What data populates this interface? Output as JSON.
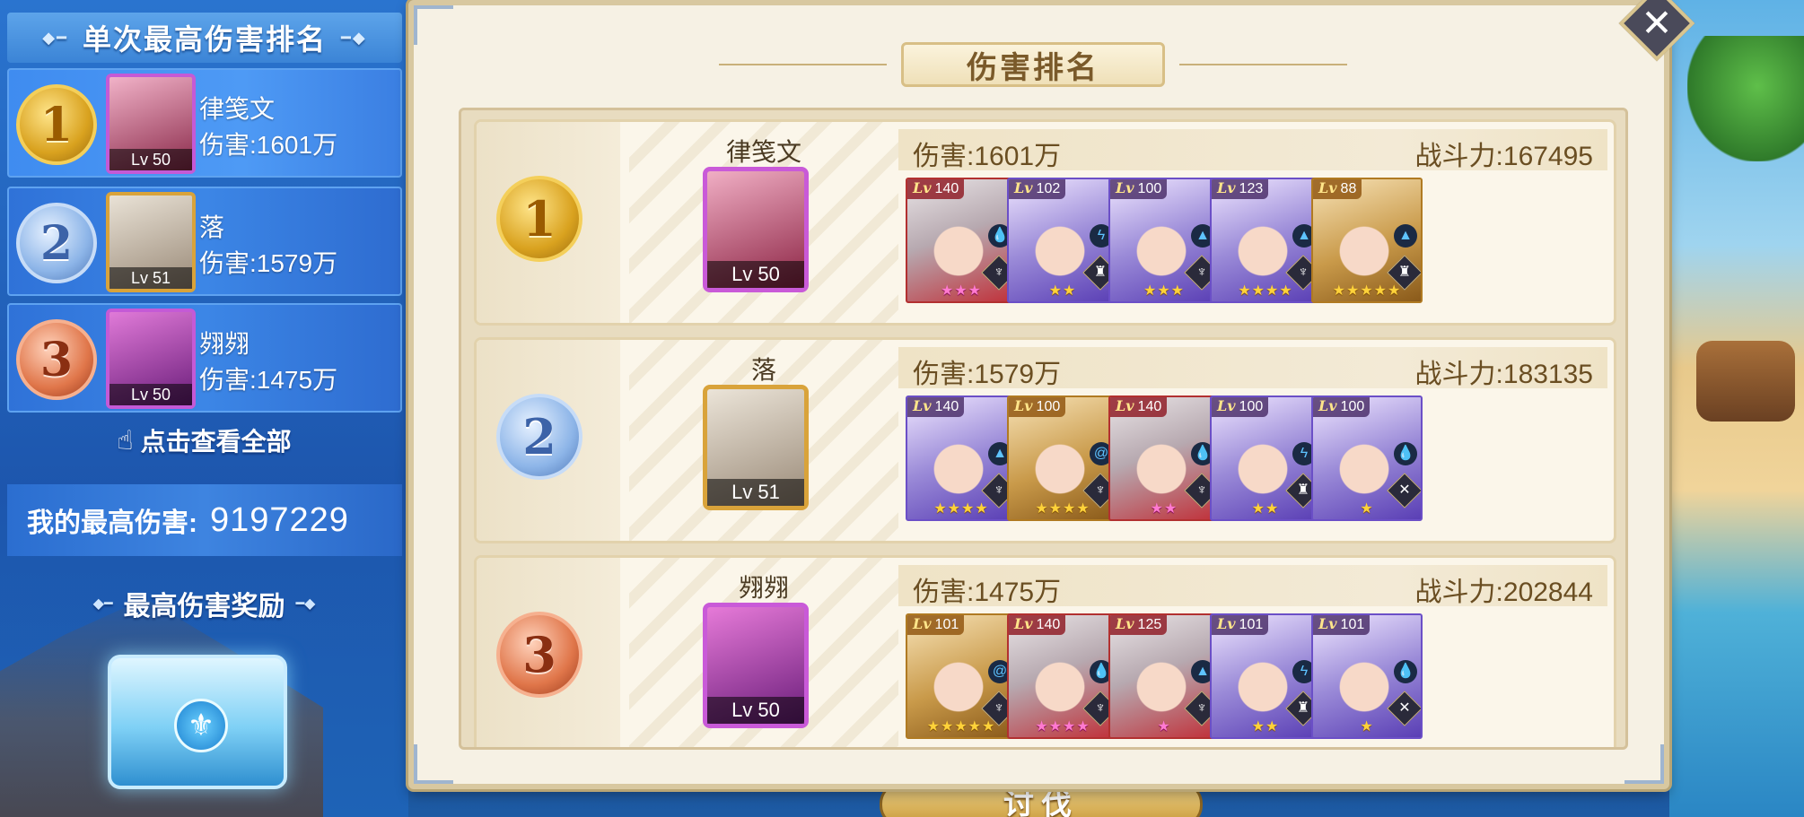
{
  "left_panel": {
    "title": "单次最高伤害排名",
    "ranks": [
      {
        "rank": "1",
        "name": "律笺文",
        "damage": "伤害:1601万",
        "level": "Lv 50"
      },
      {
        "rank": "2",
        "name": "落",
        "damage": "伤害:1579万",
        "level": "Lv 51"
      },
      {
        "rank": "3",
        "name": "翙翙",
        "damage": "伤害:1475万",
        "level": "Lv 50"
      }
    ],
    "view_all": "点击查看全部",
    "my_best_label": "我的最高伤害:",
    "my_best_value": "9197229",
    "reward_title": "最高伤害奖励"
  },
  "dialog": {
    "title": "伤害排名",
    "close_icon": "close-x",
    "rows": [
      {
        "rank": "1",
        "name": "律笺文",
        "level": "Lv 50",
        "damage": "伤害:1601万",
        "power": "战斗力:167495",
        "heroes": [
          {
            "level": "140",
            "rarity": "red",
            "element": "water",
            "stars": "★★★"
          },
          {
            "level": "102",
            "rarity": "purple",
            "element": "lightning",
            "stars": "★★"
          },
          {
            "level": "100",
            "rarity": "purple",
            "element": "earth",
            "stars": "★★★"
          },
          {
            "level": "123",
            "rarity": "purple",
            "element": "earth",
            "stars": "★★★★"
          },
          {
            "level": "88",
            "rarity": "gold",
            "element": "earth",
            "stars": "★★★★★"
          }
        ]
      },
      {
        "rank": "2",
        "name": "落",
        "level": "Lv 51",
        "damage": "伤害:1579万",
        "power": "战斗力:183135",
        "heroes": [
          {
            "level": "140",
            "rarity": "purple",
            "element": "earth",
            "stars": "★★★★"
          },
          {
            "level": "100",
            "rarity": "gold",
            "element": "wind",
            "stars": "★★★★"
          },
          {
            "level": "140",
            "rarity": "red",
            "element": "water",
            "stars": "★★"
          },
          {
            "level": "100",
            "rarity": "purple",
            "element": "lightning",
            "stars": "★★"
          },
          {
            "level": "100",
            "rarity": "purple",
            "element": "water",
            "stars": "★"
          }
        ]
      },
      {
        "rank": "3",
        "name": "翙翙",
        "level": "Lv 50",
        "damage": "伤害:1475万",
        "power": "战斗力:202844",
        "heroes": [
          {
            "level": "101",
            "rarity": "gold",
            "element": "wind",
            "stars": "★★★★★"
          },
          {
            "level": "140",
            "rarity": "red",
            "element": "water",
            "stars": "★★★★"
          },
          {
            "level": "125",
            "rarity": "red",
            "element": "earth",
            "stars": "★"
          },
          {
            "level": "101",
            "rarity": "purple",
            "element": "lightning",
            "stars": "★★"
          },
          {
            "level": "101",
            "rarity": "purple",
            "element": "water",
            "stars": "★"
          }
        ]
      }
    ],
    "bottom_button": "讨伐"
  }
}
